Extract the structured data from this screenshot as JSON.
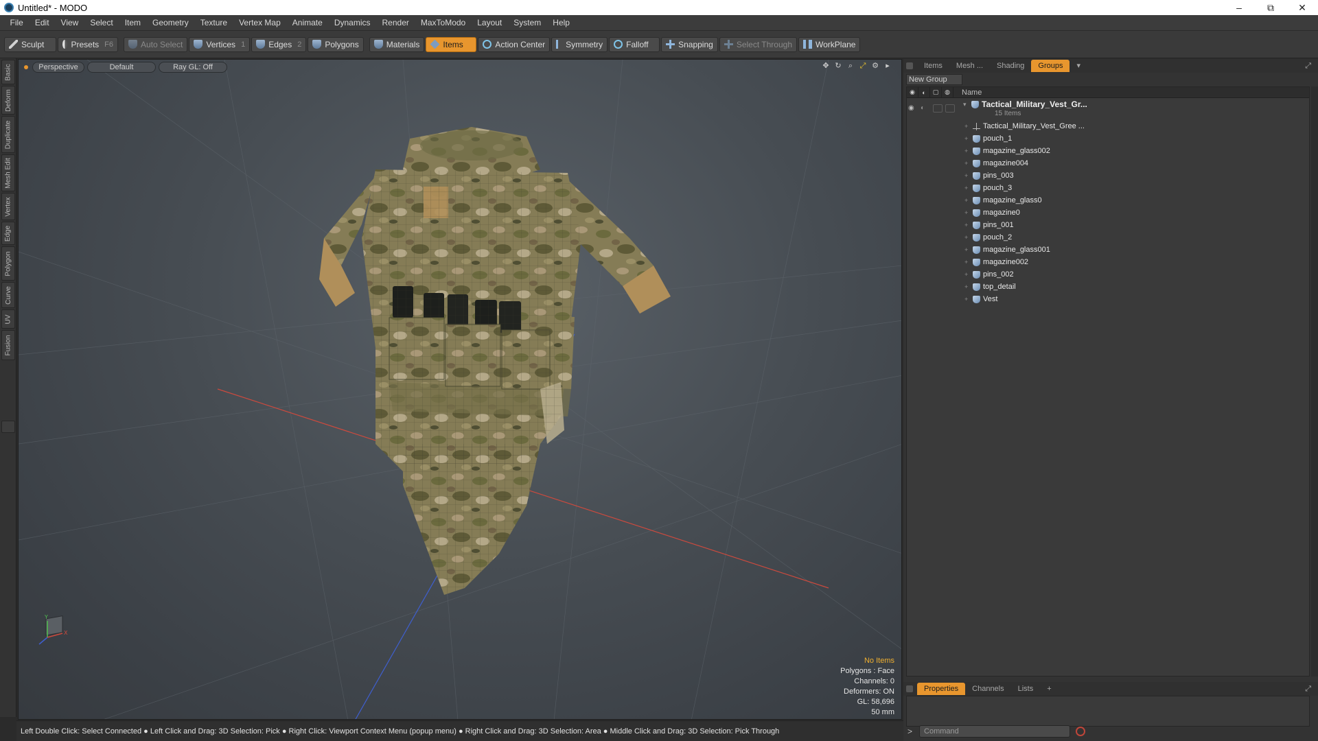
{
  "window": {
    "title": "Untitled* - MODO",
    "minimize": "–",
    "maximize": "⧉",
    "close": "✕"
  },
  "menu": [
    "File",
    "Edit",
    "View",
    "Select",
    "Item",
    "Geometry",
    "Texture",
    "Vertex Map",
    "Animate",
    "Dynamics",
    "Render",
    "MaxToModo",
    "Layout",
    "System",
    "Help"
  ],
  "toolbar": {
    "sculpt": "Sculpt",
    "presets": "Presets",
    "presets_key": "F6",
    "auto_select": "Auto Select",
    "vertices": "Vertices",
    "vertices_key": "1",
    "edges": "Edges",
    "edges_key": "2",
    "polygons": "Polygons",
    "materials": "Materials",
    "items": "Items",
    "action_center": "Action Center",
    "symmetry": "Symmetry",
    "falloff": "Falloff",
    "snapping": "Snapping",
    "select_through": "Select Through",
    "workplane": "WorkPlane"
  },
  "left_tabs": [
    "Basic",
    "Deform",
    "Duplicate",
    "Mesh Edit",
    "Vertex",
    "Edge",
    "Polygon",
    "Curve",
    "UV",
    "Fusion"
  ],
  "viewport": {
    "view_mode": "Perspective",
    "shading": "Default",
    "raygl": "Ray GL: Off",
    "info": {
      "no_items": "No Items",
      "polygons": "Polygons : Face",
      "channels": "Channels: 0",
      "deformers": "Deformers: ON",
      "gl": "GL: 58,696",
      "scale": "50 mm"
    },
    "axis": {
      "x": "X",
      "y": "Y"
    }
  },
  "status_bar": "Left Double Click: Select Connected ● Left Click and Drag: 3D Selection: Pick ● Right Click: Viewport Context Menu (popup menu) ● Right Click and Drag: 3D Selection: Area ● Middle Click and Drag: 3D Selection: Pick Through",
  "right_panel": {
    "tabs": [
      "Items",
      "Mesh ...",
      "Shading",
      "Groups"
    ],
    "active_tab": "Groups",
    "new_group": "New Group",
    "column_name": "Name",
    "group": {
      "name": "Tactical_Military_Vest_Gr...",
      "count": "15 Items"
    },
    "items": [
      {
        "name": "Tactical_Military_Vest_Gree ...",
        "icon": "locator-icon"
      },
      {
        "name": "pouch_1",
        "icon": "mesh-icon"
      },
      {
        "name": "magazine_glass002",
        "icon": "mesh-icon"
      },
      {
        "name": "magazine004",
        "icon": "mesh-icon"
      },
      {
        "name": "pins_003",
        "icon": "mesh-icon"
      },
      {
        "name": "pouch_3",
        "icon": "mesh-icon"
      },
      {
        "name": "magazine_glass0",
        "icon": "mesh-icon"
      },
      {
        "name": "magazine0",
        "icon": "mesh-icon"
      },
      {
        "name": "pins_001",
        "icon": "mesh-icon"
      },
      {
        "name": "pouch_2",
        "icon": "mesh-icon"
      },
      {
        "name": "magazine_glass001",
        "icon": "mesh-icon"
      },
      {
        "name": "magazine002",
        "icon": "mesh-icon"
      },
      {
        "name": "pins_002",
        "icon": "mesh-icon"
      },
      {
        "name": "top_detail",
        "icon": "mesh-icon"
      },
      {
        "name": "Vest",
        "icon": "mesh-icon"
      }
    ],
    "bottom_tabs": [
      "Properties",
      "Channels",
      "Lists",
      "+"
    ],
    "active_bottom_tab": "Properties",
    "command_prompt": ">",
    "command_placeholder": "Command"
  },
  "colors": {
    "accent": "#e8962e",
    "camo_base": "#8a8a5a",
    "axis_red": "#d0453a",
    "axis_blue": "#3a5fd0"
  }
}
